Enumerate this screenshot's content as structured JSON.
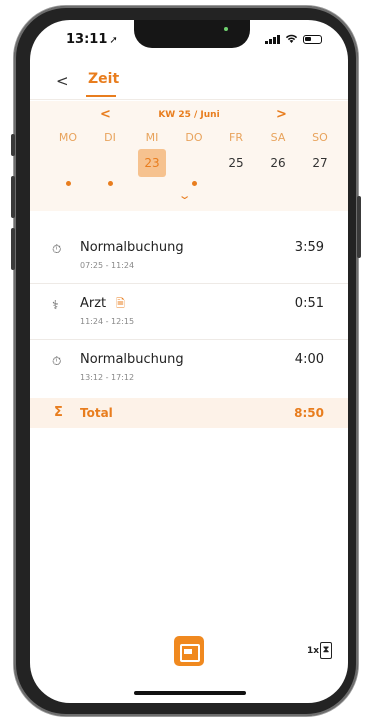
{
  "status": {
    "time": "13:11"
  },
  "header": {
    "back": "<",
    "title": "Zeit"
  },
  "week": {
    "prev": "<",
    "label": "KW 25 / Juni",
    "next": ">",
    "days": [
      {
        "name": "MO",
        "num": "",
        "dot": true
      },
      {
        "name": "DI",
        "num": "",
        "dot": true
      },
      {
        "name": "MI",
        "num": "23",
        "dot": false,
        "selected": true
      },
      {
        "name": "DO",
        "num": "",
        "dot": true
      },
      {
        "name": "FR",
        "num": "25",
        "dot": false
      },
      {
        "name": "SA",
        "num": "26",
        "dot": false
      },
      {
        "name": "SO",
        "num": "27",
        "dot": false
      }
    ]
  },
  "entries": [
    {
      "icon": "stopwatch-icon",
      "name": "Normalbuchung",
      "range": "07:25 - 11:24",
      "duration": "3:59"
    },
    {
      "icon": "stethoscope-icon",
      "name": "Arzt",
      "range": "11:24 - 12:15",
      "duration": "0:51",
      "doc": true
    },
    {
      "icon": "stopwatch-icon",
      "name": "Normalbuchung",
      "range": "13:12 - 17:12",
      "duration": "4:00"
    }
  ],
  "total": {
    "label": "Total",
    "value": "8:50"
  },
  "footer": {
    "multiplier": "1x"
  },
  "colors": {
    "accent": "#e87d1e",
    "accent_light": "#f6c28f",
    "week_bg": "#fdf6ef"
  }
}
